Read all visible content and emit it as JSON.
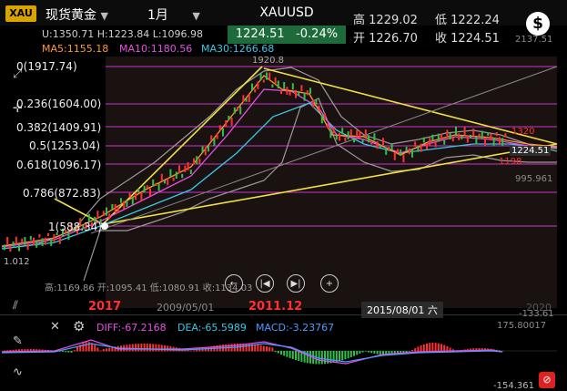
{
  "header": {
    "logo": "XAU",
    "symbol_name": "现货黄金",
    "period": "1月",
    "ticker": "XAUUSD",
    "price": "1224.51",
    "change_pct": "-0.24%",
    "high_label": "高",
    "high": "1229.02",
    "low_label": "低",
    "low": "1222.24",
    "open_label": "开",
    "open": "1226.70",
    "close_label": "收",
    "close": "1224.51",
    "dollar_icon": "$"
  },
  "legend": {
    "ohl": "U:1350.71  H:1223.84  L:1096.98",
    "ma5": "MA5:1155.18",
    "ma10": "MA10:1180.56",
    "ma30": "MA30:1266.68"
  },
  "fib_levels": [
    {
      "label": "0(1917.74)"
    },
    {
      "label": "0.236(1604.00)"
    },
    {
      "label": "0.382(1409.91)"
    },
    {
      "label": "0.5(1253.04)"
    },
    {
      "label": "0.618(1096.17)"
    },
    {
      "label": "0.786(872.83)"
    },
    {
      "label": "1(588.34)"
    }
  ],
  "chart_labels": {
    "peak": "1920.8",
    "left_low": "1.012",
    "right_top": "2137.51",
    "r1320": "1320",
    "r1224": "1224.51",
    "r1198": "1198",
    "r995": "995.961",
    "bottom_info": "高:1169.86 开:1095.41 低:1080.91 收:1134.03",
    "neg133": "-133.61"
  },
  "time_axis": {
    "year_2017": "2017",
    "d2009": "2009/05/01",
    "year_2011": "2011.12",
    "d2015": "2015/08/01 六",
    "d2020": "2020"
  },
  "controls": {
    "prev": "←",
    "first": "|◀",
    "last": "▶|",
    "zoom": "+"
  },
  "macd": {
    "diff": "DIFF:-67.2168",
    "dea": "DEA:-65.5989",
    "macd": "MACD:-3.23767",
    "top": "175.80017",
    "bottom": "-154.361"
  },
  "colors": {
    "up": "#ff3030",
    "down": "#2fc04a",
    "fib": "#cc33cc",
    "trend": "#f0e040",
    "ma5": "#ff9a2e",
    "ma10": "#e64fe6",
    "ma30": "#35c9e6"
  }
}
